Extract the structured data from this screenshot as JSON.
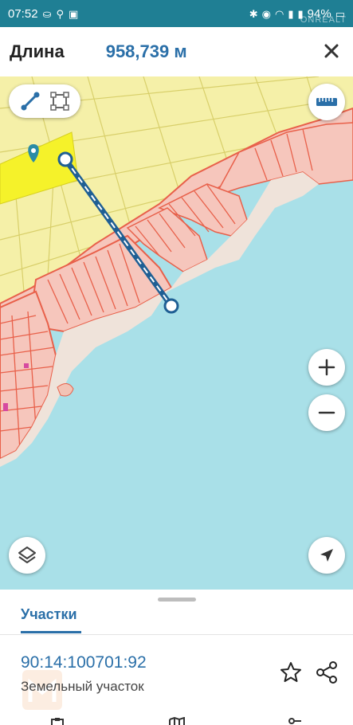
{
  "status_bar": {
    "time": "07:52",
    "battery": "94%",
    "watermark": "ONREALT"
  },
  "header": {
    "title": "Длина",
    "value": "958,739 м"
  },
  "map": {
    "icons": {
      "line_tool": "polyline-icon",
      "area_tool": "polygon-icon",
      "ruler": "ruler-icon",
      "zoom_in": "plus-icon",
      "zoom_out": "minus-icon",
      "layers": "layers-icon",
      "locate": "navigation-arrow-icon",
      "pin": "map-pin-icon"
    },
    "colors": {
      "water": "#a9e0e8",
      "land_yellow": "#f5f0a8",
      "parcel_fill": "#f6c6bc",
      "parcel_line": "#e8604a",
      "measure_line": "#1f5f94",
      "highlight": "#f5f22a"
    }
  },
  "sheet": {
    "tab_label": "Участки",
    "parcel_id": "90:14:100701:92",
    "parcel_type": "Земельный участок",
    "icons": {
      "favorite": "star-icon",
      "share": "share-icon"
    }
  }
}
